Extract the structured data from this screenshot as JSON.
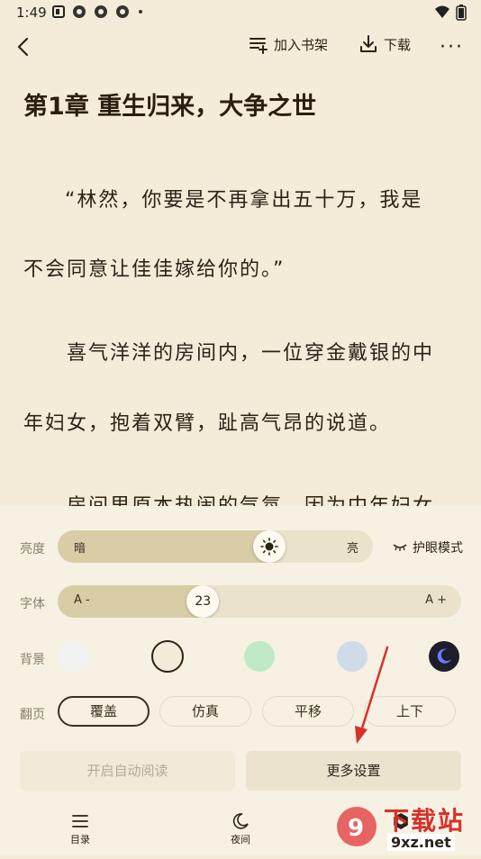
{
  "status": {
    "time": "1:49"
  },
  "toolbar": {
    "add_shelf": "加入书架",
    "download": "下载"
  },
  "chapter": {
    "title": "第1章 重生归来，大争之世",
    "lines": [
      "“林然，你要是不再拿出五十万，我是",
      "不会同意让佳佳嫁给你的。”",
      "喜气洋洋的房间内，一位穿金戴银的中",
      "年妇女，抱着双臂，趾高气昂的说道。",
      "房间里原本热闹的气氛，因为中年妇女"
    ]
  },
  "settings": {
    "brightness": {
      "label": "亮度",
      "low": "暗",
      "high": "亮",
      "level": 0.67,
      "eye_mode": "护眼模式"
    },
    "font": {
      "label": "字体",
      "minus": "A -",
      "plus": "A +",
      "size": "23",
      "level": 0.36
    },
    "background": {
      "label": "背景",
      "colors": [
        "#f2f2f2",
        "#f4ecd8",
        "#bfe9c8",
        "#cfdbe9",
        "#1e1e2a"
      ],
      "selected": 1
    },
    "paging": {
      "label": "翻页",
      "options": [
        "覆盖",
        "仿真",
        "平移",
        "上下"
      ],
      "selected": 0
    },
    "auto_read": "开启自动阅读",
    "more": "更多设置"
  },
  "nav": {
    "toc": "目录",
    "night": "夜间",
    "settings": "设置"
  },
  "watermark": {
    "text": "下载站",
    "domain": "9xz.net"
  }
}
